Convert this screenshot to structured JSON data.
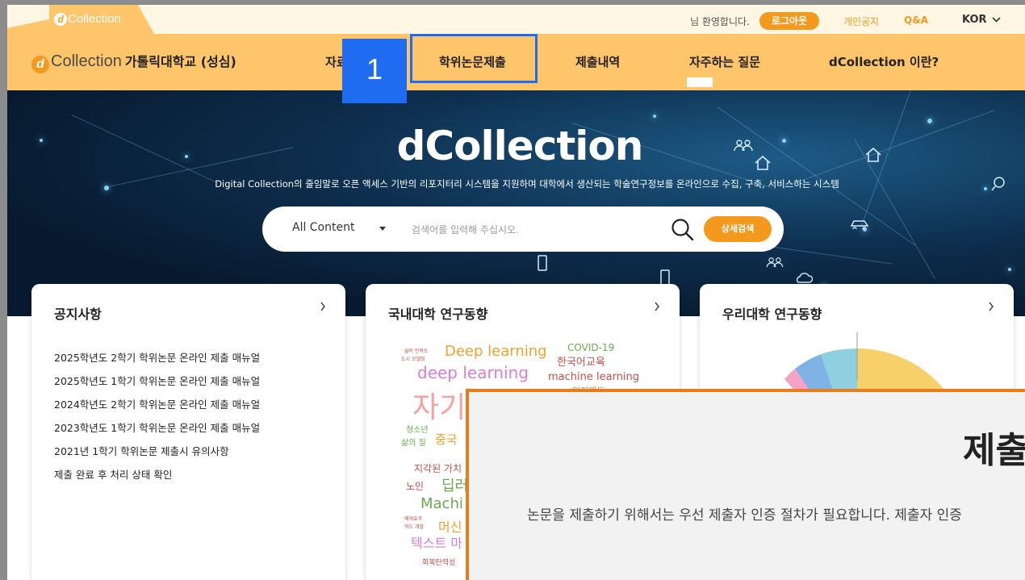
{
  "topbar": {
    "logo_text": "Collection",
    "welcome": "님 환영합니다.",
    "logout_label": "로그아웃",
    "privacy_label": "개인공지",
    "qna_label": "Q&A",
    "lang_label": "KOR"
  },
  "nav": {
    "brand_text": "Collection",
    "school_name": "가톨릭대학교 (성심)",
    "items": [
      "자료검색",
      "학위논문제출",
      "제출내역",
      "자주하는 질문",
      "dCollection 이란?"
    ],
    "step_badge": "1"
  },
  "hero": {
    "title": "dCollection",
    "subtitle": "Digital Collection의 줄임말로 오픈 액세스 기반의 리포지터리 시스템을 지원하며 대학에서 생산되는 학술연구정보를 온라인으로 수집, 구축, 서비스하는 시스템",
    "search_scope": "All Content",
    "search_placeholder": "검색어를 입력해 주십시오.",
    "advanced_search_label": "상세검색"
  },
  "cards": {
    "notice": {
      "title": "공지사항",
      "items": [
        "2025학년도 2학기 학위논문 온라인 제출 매뉴얼",
        "2025학년도 1학기 학위논문 온라인 제출 매뉴얼",
        "2024학년도 2학기 학위논문 온라인 제출 매뉴얼",
        "2023학년도 1학기 학위논문 온라인 제출 매뉴얼",
        "2021년 1학기 학위논문 제출시 유의사항",
        "제출 완료 후 처리 상태 확인"
      ]
    },
    "domestic": {
      "title": "국내대학 연구동향",
      "words": [
        "Deep learning",
        "COVID-19",
        "한국어교육",
        "deep learning",
        "machine learning",
        "자기",
        "인지왜도",
        "청소년",
        "삶의 질",
        "중국",
        "지각된 가치",
        "노인",
        "딥러",
        "Machi",
        "머신",
        "텍스트 마",
        "회복탄력성",
        "삶의 만족도",
        "도시 모델링",
        "매개효과",
        "척도 개발"
      ]
    },
    "ours": {
      "title": "우리대학 연구동향"
    }
  },
  "modal": {
    "title": "제출",
    "text": "논문을 제출하기 위해서는 우선 제출자 인증 절차가 필요합니다. 제출자 인증"
  },
  "colors": {
    "accent": "#f39a1e",
    "nav_bg": "#ffc56b",
    "highlight": "#1f6cf0",
    "modal_border": "#e87d1e"
  }
}
